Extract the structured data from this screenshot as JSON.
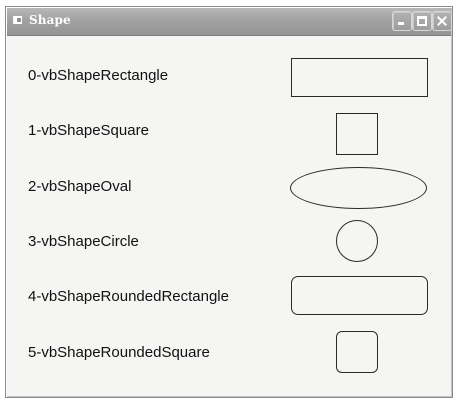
{
  "window": {
    "title": "Shape"
  },
  "icons": {
    "app": "app-icon",
    "minimize": "minimize-icon",
    "maximize": "maximize-icon",
    "close": "close-icon"
  },
  "labels": [
    "0-vbShapeRectangle",
    "1-vbShapeSquare",
    "2-vbShapeOval",
    "3-vbShapeCircle",
    "4-vbShapeRoundedRectangle",
    "5-vbShapeRoundedSquare"
  ],
  "colors": {
    "titlebar": "#a2a2a2",
    "client": "#f5f5f3",
    "border": "#2a2a2a"
  }
}
